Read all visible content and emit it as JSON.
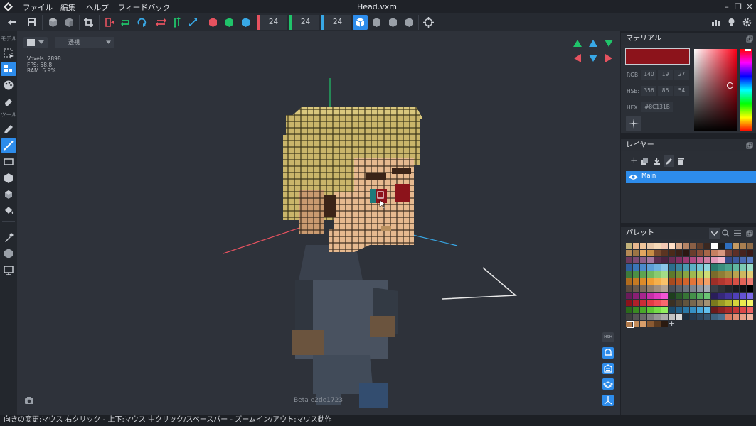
{
  "menubar": {
    "items": [
      "ファイル",
      "編集",
      "ヘルプ",
      "フィードバック"
    ],
    "file_title": "Head.vxm"
  },
  "toolbar": {
    "mirror_counts": [
      "24",
      "24",
      "24"
    ],
    "mirror_colors": [
      "#e6525f",
      "#20c36a",
      "#38a8e6"
    ]
  },
  "leftbar": {
    "group_model": "モデル",
    "group_tools": "ツール"
  },
  "viewport": {
    "view_mode": "透視",
    "stats": {
      "voxels": "Voxels: 2898",
      "fps": "FPS: 58.8",
      "ram": "RAM: 6.9%"
    },
    "beta_label": "Beta e2de1723",
    "hsh_label": "HSH"
  },
  "material": {
    "title": "マテリアル",
    "color": "#8C131B",
    "rgb_label": "RGB:",
    "rgb": [
      "140",
      "19",
      "27"
    ],
    "hsb_label": "HSB:",
    "hsb": [
      "356",
      "86",
      "54"
    ],
    "hex_label": "HEX:",
    "hex": "#8C131B"
  },
  "layers": {
    "title": "レイヤー",
    "items": [
      {
        "name": "Main",
        "visible": true,
        "selected": true
      }
    ]
  },
  "palette": {
    "title": "パレット",
    "add_symbol": "+",
    "colors": [
      "#c2b27a",
      "#e8b78e",
      "#f0c59b",
      "#e9c8a8",
      "#f6d9b7",
      "#f3c9b4",
      "#ffe0c8",
      "#d7a98a",
      "#b58466",
      "#8a5f45",
      "#5e3d2c",
      "#3b2820",
      "#ffffff",
      "#1f1f1f",
      "#2e6fbf",
      "#c49a62",
      "#a87e50",
      "#8e6b48",
      "#b58a55",
      "#9c7544",
      "#e2a660",
      "#c98e46",
      "#7a4a2d",
      "#5b3421",
      "#4a2a1a",
      "#3a2118",
      "#2b1812",
      "#6a3d2b",
      "#8a4f38",
      "#a86648",
      "#c48062",
      "#d89880",
      "#784236",
      "#5d2f27",
      "#46231f",
      "#3b1a17",
      "#6e3a5e",
      "#7d4b74",
      "#8f5f88",
      "#a5769e",
      "#5a2d4f",
      "#4a2341",
      "#6b2c55",
      "#842f63",
      "#9b3b73",
      "#b04b82",
      "#c56694",
      "#d07fa2",
      "#e29abb",
      "#f2b8cf",
      "#354a8a",
      "#3d5aa0",
      "#4a6bb5",
      "#5b7dc4",
      "#2f5f9e",
      "#3a76b8",
      "#4b8acb",
      "#5c9ed6",
      "#6fb1de",
      "#8bc5e8",
      "#2c6e8c",
      "#3a849f",
      "#4a9ab2",
      "#5cb0c4",
      "#73c4d3",
      "#92d6de",
      "#2a7a6d",
      "#3a8f7e",
      "#4aa38f",
      "#60b7a0",
      "#7ccab3",
      "#9adcc6",
      "#3d7a3b",
      "#4c8f45",
      "#5ea451",
      "#72b85e",
      "#8acb70",
      "#a3dc87",
      "#5e7a2b",
      "#738f36",
      "#89a442",
      "#a0b84f",
      "#b7cc5f",
      "#cfdc75",
      "#7a6b2b",
      "#8f7d36",
      "#a49042",
      "#b9a34f",
      "#cdb75f",
      "#e0cb75",
      "#b06b1e",
      "#c77a22",
      "#dd8b29",
      "#ef9d34",
      "#f5b04c",
      "#f8c26a",
      "#a84a1e",
      "#be5624",
      "#d3642c",
      "#e47438",
      "#ec8a4e",
      "#f2a068",
      "#9e2f28",
      "#b2372f",
      "#c54238",
      "#d65045",
      "#e26358",
      "#ec7a70",
      "#5a4a3e",
      "#6b5a4c",
      "#7c6b5c",
      "#8e7d6d",
      "#a08f80",
      "#b3a394",
      "#4a4f57",
      "#5a6069",
      "#6b727c",
      "#7e858f",
      "#9198a2",
      "#a6acb5",
      "#3a3f47",
      "#2e3238",
      "#22262b",
      "#181b1f",
      "#0f1114",
      "#000000",
      "#6a1b5a",
      "#8a1f74",
      "#a8258e",
      "#c62fa8",
      "#e03cc0",
      "#f255d4",
      "#1e3f1e",
      "#2a5a2a",
      "#367536",
      "#44904a",
      "#55ab5e",
      "#6ac574",
      "#2a1e5a",
      "#36287a",
      "#42339a",
      "#5040b8",
      "#6352d2",
      "#7a68e6",
      "#8c131b",
      "#b0202a",
      "#cc2b36",
      "#e23a45",
      "#f04e58",
      "#f8686f",
      "#3a3022",
      "#4e4230",
      "#62543e",
      "#78684e",
      "#8e7c60",
      "#a49274",
      "#7a7a1e",
      "#9a9a26",
      "#b8b830",
      "#d4d43c",
      "#eaea4e",
      "#f6f66a",
      "#2b6a1b",
      "#3a8a22",
      "#4aa82a",
      "#5ec436",
      "#76dc48",
      "#92ee60",
      "#1b4a6a",
      "#22618a",
      "#2a78a8",
      "#3690c4",
      "#48a8dc",
      "#62c0ee",
      "#6a1b1b",
      "#8a2222",
      "#a82a2a",
      "#c43636",
      "#dc4848",
      "#ee6262",
      "#3f3f3f",
      "#545454",
      "#6a6a6a",
      "#808080",
      "#969696",
      "#acacac",
      "#c2c2c2",
      "#d8d8d8",
      "#1c2d3f",
      "#24394f",
      "#2c465f",
      "#35546f",
      "#3f627f",
      "#4a7090",
      "#d87a60",
      "#e08d74",
      "#e8a088",
      "#f0b49e",
      "#b07a4c",
      "#c48c5a",
      "#d89e6a",
      "#8a5a32",
      "#5a3a20",
      "#2a1a10"
    ]
  }
}
